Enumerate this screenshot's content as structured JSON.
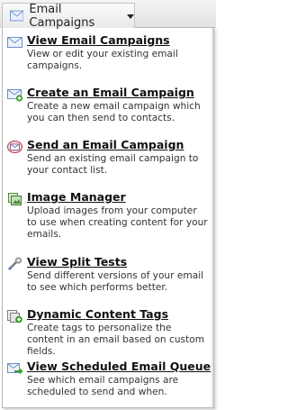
{
  "trigger": {
    "label": "Email Campaigns"
  },
  "menu": {
    "items": [
      {
        "title": "View Email Campaigns",
        "desc": "View or edit your existing email campaigns."
      },
      {
        "title": "Create an Email Campaign",
        "desc": "Create a new email campaign which you can then send to contacts."
      },
      {
        "title": "Send an Email Campaign",
        "desc": "Send an existing email campaign to your contact list."
      },
      {
        "title": "Image Manager",
        "desc": "Upload images from your computer to use when creating content for your emails."
      },
      {
        "title": "View Split Tests",
        "desc": "Send different versions of your email to see which performs better."
      },
      {
        "title": "Dynamic Content Tags",
        "desc": "Create tags to personalize the content in an email based on custom fields."
      },
      {
        "title": "View Scheduled Email Queue",
        "desc": "See which email campaigns are scheduled to send and when."
      }
    ]
  },
  "colors": {
    "link": "#111111",
    "envelope": "#6b8fc8",
    "add": "#3d9a2e",
    "send": "#c23b3b"
  },
  "icons": [
    "envelope-icon",
    "envelope-add-icon",
    "envelope-send-icon",
    "image-manager-icon",
    "split-test-icon",
    "dynamic-content-icon",
    "scheduled-queue-icon"
  ]
}
